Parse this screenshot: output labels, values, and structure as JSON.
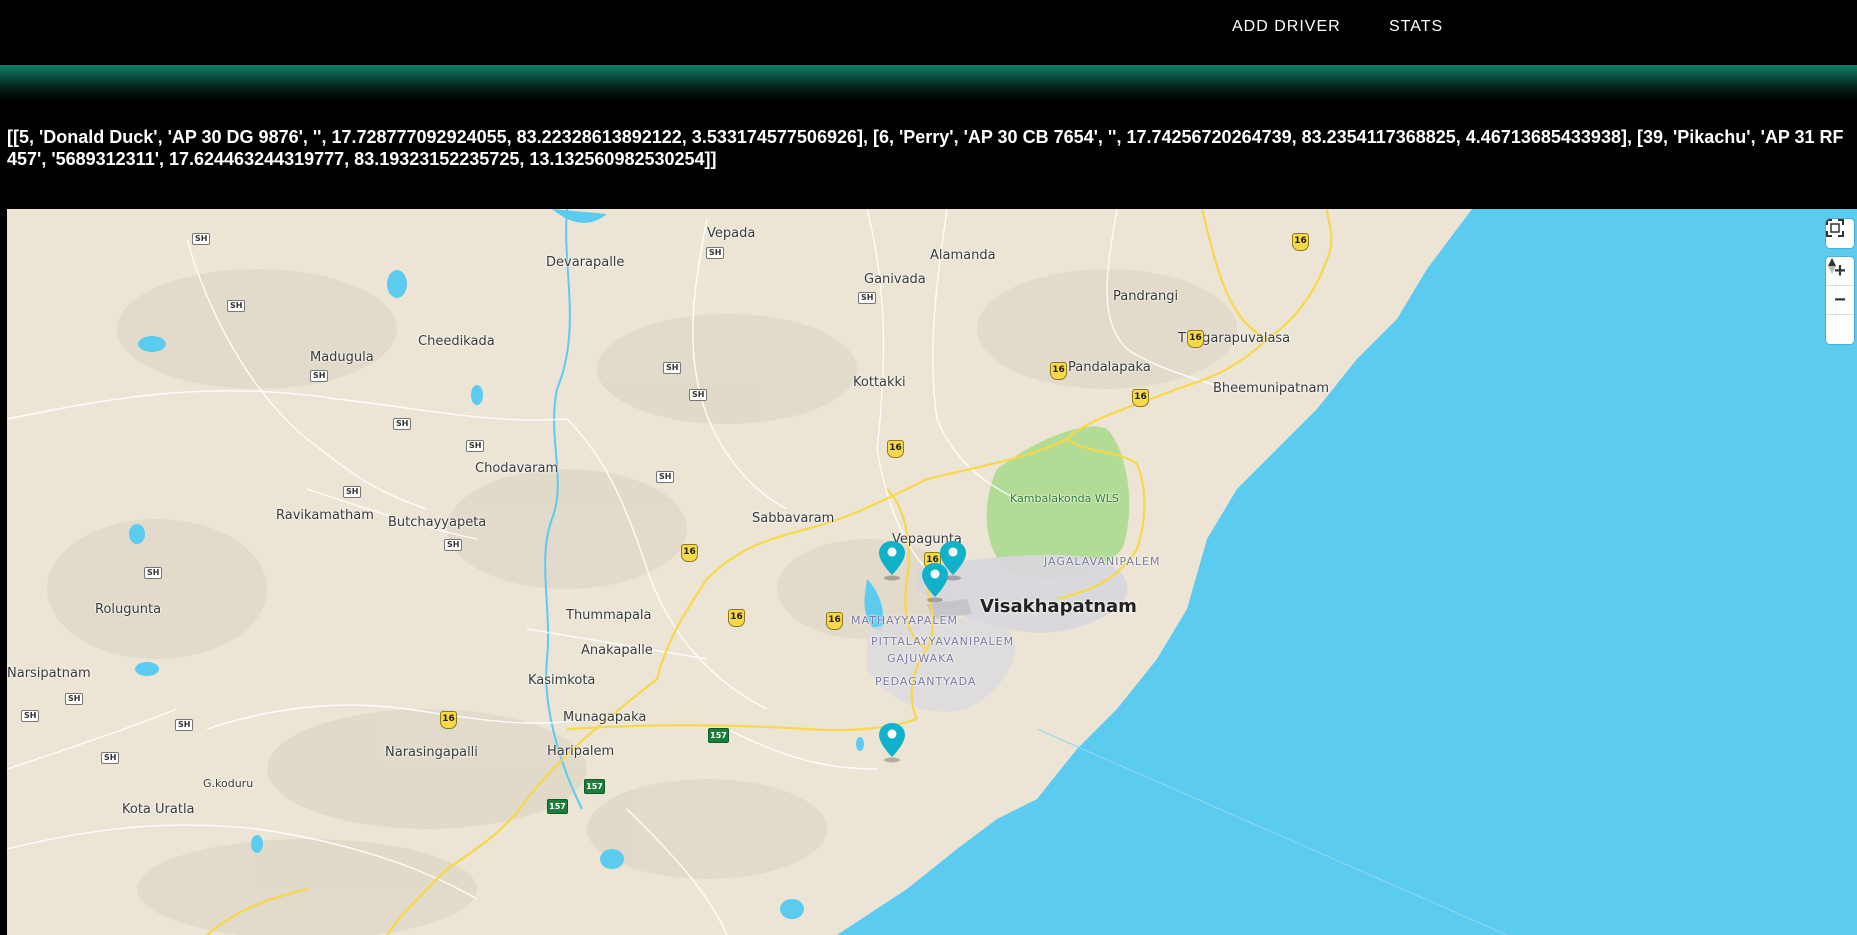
{
  "nav": {
    "add_driver": "ADD DRIVER",
    "stats": "STATS"
  },
  "drivers_text": "[[5, 'Donald Duck', 'AP 30 DG 9876', '', 17.728777092924055, 83.22328613892122, 3.533174577506926], [6, 'Perry', 'AP 30 CB 7654', '', 17.74256720264739, 83.2354117368825, 4.46713685433938], [39, 'Pikachu', 'AP 31 RF 457', '5689312311', 17.624463244319777, 83.19323152235725, 13.132560982530254]]",
  "map": {
    "controls": {
      "fullscreen_icon": "fullscreen-icon",
      "zoom_in": "+",
      "zoom_out": "−",
      "compass": "compass-icon"
    },
    "colors": {
      "land": "#ece5d6",
      "sea": "#5bcbf0",
      "park": "#a8d98a",
      "marker": "#0fb2c9",
      "highway": "#f6d84a"
    },
    "places": [
      {
        "name": "Vepada"
      },
      {
        "name": "Devarapalle"
      },
      {
        "name": "Alamanda"
      },
      {
        "name": "Ganivada"
      },
      {
        "name": "Pandrangi"
      },
      {
        "name": "Thagarapuvalasa"
      },
      {
        "name": "Madugula"
      },
      {
        "name": "Cheedikada"
      },
      {
        "name": "Pandalapaka"
      },
      {
        "name": "Kottakki"
      },
      {
        "name": "Bheemunipatnam"
      },
      {
        "name": "Chodavaram"
      },
      {
        "name": "Kambalakonda WLS"
      },
      {
        "name": "Ravikamatham"
      },
      {
        "name": "Butchayyapeta"
      },
      {
        "name": "Sabbavaram"
      },
      {
        "name": "Vepagunta"
      },
      {
        "name": "JAGALAVANIPALEM"
      },
      {
        "name": "Visakhapatnam"
      },
      {
        "name": "Rolugunta"
      },
      {
        "name": "Thummapala"
      },
      {
        "name": "MATHAYYAPALEM"
      },
      {
        "name": "PITTALAYYAVANIPALEM"
      },
      {
        "name": "Anakapalle"
      },
      {
        "name": "GAJUWAKA"
      },
      {
        "name": "Narsipatnam"
      },
      {
        "name": "Kasimkota"
      },
      {
        "name": "PEDAGANTYADA"
      },
      {
        "name": "Munagapaka"
      },
      {
        "name": "Narasingapalli"
      },
      {
        "name": "Haripalem"
      },
      {
        "name": "G.koduru"
      },
      {
        "name": "Kota Uratla"
      }
    ],
    "shields": {
      "sh": "SH",
      "nh16": "16",
      "nh157": "157"
    },
    "markers": [
      {
        "id": 5
      },
      {
        "id": 6
      },
      {
        "id": 39
      },
      {
        "id": "extra"
      }
    ]
  }
}
